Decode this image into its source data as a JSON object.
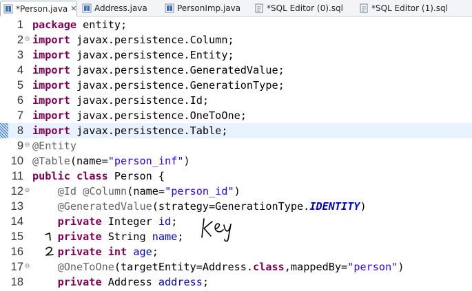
{
  "tabs": [
    {
      "label": "*Person.java",
      "icon": "java-file-icon",
      "active": true
    },
    {
      "label": "Address.java",
      "icon": "java-file-icon",
      "active": false
    },
    {
      "label": "PersonImp.java",
      "icon": "java-file-icon",
      "active": false
    },
    {
      "label": "*SQL Editor (0).sql",
      "icon": "sql-file-icon",
      "active": false
    },
    {
      "label": "*SQL Editor (1).sql",
      "icon": "sql-file-icon",
      "active": false
    }
  ],
  "tab_close_glyph": "✕",
  "editor": {
    "current_line": 8,
    "lines": [
      {
        "n": "1",
        "fold": "",
        "tokens": [
          {
            "t": "package",
            "c": "kw"
          },
          {
            "t": " entity;"
          }
        ]
      },
      {
        "n": "2",
        "fold": "⊖",
        "tokens": [
          {
            "t": "import",
            "c": "kw"
          },
          {
            "t": " javax.persistence.Column;"
          }
        ]
      },
      {
        "n": "3",
        "fold": "",
        "tokens": [
          {
            "t": "import",
            "c": "kw"
          },
          {
            "t": " javax.persistence.Entity;"
          }
        ]
      },
      {
        "n": "4",
        "fold": "",
        "tokens": [
          {
            "t": "import",
            "c": "kw"
          },
          {
            "t": " javax.persistence.GeneratedValue;"
          }
        ]
      },
      {
        "n": "5",
        "fold": "",
        "tokens": [
          {
            "t": "import",
            "c": "kw"
          },
          {
            "t": " javax.persistence.GenerationType;"
          }
        ]
      },
      {
        "n": "6",
        "fold": "",
        "tokens": [
          {
            "t": "import",
            "c": "kw"
          },
          {
            "t": " javax.persistence.Id;"
          }
        ]
      },
      {
        "n": "7",
        "fold": "",
        "tokens": [
          {
            "t": "import",
            "c": "kw"
          },
          {
            "t": " javax.persistence.OneToOne;"
          }
        ]
      },
      {
        "n": "8",
        "fold": "",
        "tokens": [
          {
            "t": "import",
            "c": "kw"
          },
          {
            "t": " javax.persistence.Table;"
          }
        ]
      },
      {
        "n": "9",
        "fold": "⊖",
        "tokens": [
          {
            "t": "@Entity",
            "c": "ann"
          }
        ]
      },
      {
        "n": "10",
        "fold": "",
        "tokens": [
          {
            "t": "@Table",
            "c": "ann"
          },
          {
            "t": "(name="
          },
          {
            "t": "\"person_inf\"",
            "c": "str"
          },
          {
            "t": ")"
          }
        ]
      },
      {
        "n": "11",
        "fold": "",
        "tokens": [
          {
            "t": "public",
            "c": "kw"
          },
          {
            "t": " "
          },
          {
            "t": "class",
            "c": "kw"
          },
          {
            "t": " Person {"
          }
        ]
      },
      {
        "n": "12",
        "fold": "⊖",
        "tokens": [
          {
            "t": "    "
          },
          {
            "t": "@Id",
            "c": "ann"
          },
          {
            "t": " "
          },
          {
            "t": "@Column",
            "c": "ann"
          },
          {
            "t": "(name="
          },
          {
            "t": "\"person_id\"",
            "c": "str"
          },
          {
            "t": ")"
          }
        ]
      },
      {
        "n": "13",
        "fold": "",
        "tokens": [
          {
            "t": "    "
          },
          {
            "t": "@GeneratedValue",
            "c": "ann"
          },
          {
            "t": "(strategy=GenerationType."
          },
          {
            "t": "IDENTITY",
            "c": "konst"
          },
          {
            "t": ")"
          }
        ]
      },
      {
        "n": "14",
        "fold": "",
        "tokens": [
          {
            "t": "    "
          },
          {
            "t": "private",
            "c": "kw"
          },
          {
            "t": " Integer "
          },
          {
            "t": "id",
            "c": "field"
          },
          {
            "t": ";"
          }
        ]
      },
      {
        "n": "15",
        "fold": "",
        "tokens": [
          {
            "t": "    "
          },
          {
            "t": "private",
            "c": "kw"
          },
          {
            "t": " String "
          },
          {
            "t": "name",
            "c": "field"
          },
          {
            "t": ";"
          }
        ]
      },
      {
        "n": "16",
        "fold": "",
        "tokens": [
          {
            "t": "    "
          },
          {
            "t": "private",
            "c": "kw"
          },
          {
            "t": " "
          },
          {
            "t": "int",
            "c": "kw"
          },
          {
            "t": " "
          },
          {
            "t": "age",
            "c": "field"
          },
          {
            "t": ";"
          }
        ]
      },
      {
        "n": "17",
        "fold": "⊖",
        "tokens": [
          {
            "t": "    "
          },
          {
            "t": "@OneToOne",
            "c": "ann"
          },
          {
            "t": "(targetEntity=Address."
          },
          {
            "t": "class",
            "c": "kw"
          },
          {
            "t": ",mappedBy="
          },
          {
            "t": "\"person\"",
            "c": "str"
          },
          {
            "t": ")"
          }
        ]
      },
      {
        "n": "18",
        "fold": "",
        "tokens": [
          {
            "t": "    "
          },
          {
            "t": "private",
            "c": "kw"
          },
          {
            "t": " Address "
          },
          {
            "t": "address",
            "c": "field"
          },
          {
            "t": ";"
          }
        ]
      }
    ]
  },
  "handwriting": {
    "annotations": [
      "key",
      "1",
      "2"
    ],
    "color": "#000000"
  },
  "colors": {
    "keyword": "#7f0055",
    "annotation": "#646464",
    "string": "#2a00ff",
    "field": "#0000c0",
    "current_line": "#e8f2fe"
  }
}
